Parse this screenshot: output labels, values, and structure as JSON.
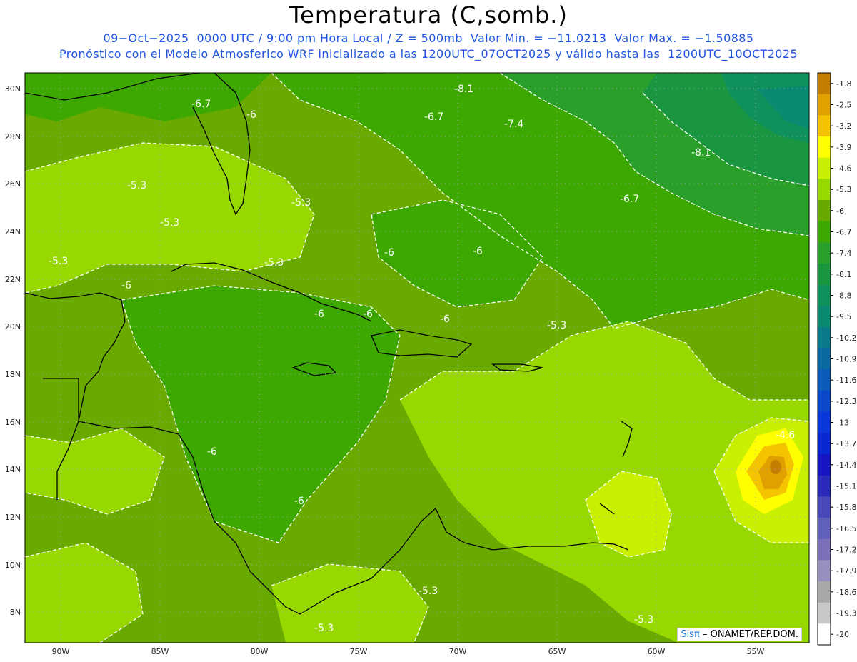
{
  "title": "Temperatura (C,somb.)",
  "subtitle_line1": "09−Oct−2025  0000 UTC / 9:00 pm Hora Local / Z = 500mb  Valor Min. = −11.0213  Valor Max. = −1.50885",
  "subtitle_line2": "Pronóstico con el Modelo Atmosferico WRF inicializado a las 1200UTC_07OCT2025 y válido hasta las  1200UTC_10OCT2025",
  "map": {
    "lon_ticks": [
      "90W",
      "85W",
      "80W",
      "75W",
      "70W",
      "65W",
      "60W",
      "55W"
    ],
    "lat_ticks": [
      "30N",
      "28N",
      "26N",
      "24N",
      "22N",
      "20N",
      "18N",
      "16N",
      "14N",
      "12N",
      "10N",
      "8N"
    ],
    "contour_labels": [
      "-6.7",
      "-6",
      "-8.1",
      "-6.7",
      "-7.4",
      "-8.1",
      "-5.3",
      "-5.3",
      "-5.3",
      "-6.7",
      "-5.3",
      "-6",
      "-6",
      "-5.3",
      "-6",
      "-6",
      "-6",
      "-6",
      "-5.3",
      "-4.6",
      "-6",
      "-6",
      "-5.3",
      "-5.3",
      "-5.3"
    ]
  },
  "colorbar": {
    "labels": [
      "-1.8",
      "-2.5",
      "-3.2",
      "-3.9",
      "-4.6",
      "-5.3",
      "-6",
      "-6.7",
      "-7.4",
      "-8.1",
      "-8.8",
      "-9.5",
      "-10.2",
      "-10.9",
      "-11.6",
      "-12.3",
      "-13",
      "-13.7",
      "-14.4",
      "-15.1",
      "-15.8",
      "-16.5",
      "-17.2",
      "-17.9",
      "-18.6",
      "-19.3",
      "-20"
    ],
    "colors": [
      "#c47f00",
      "#e0a000",
      "#f5c400",
      "#ffff00",
      "#c8f000",
      "#96d800",
      "#6aaa00",
      "#3ca800",
      "#2aa02a",
      "#1a9640",
      "#10905a",
      "#0a8a70",
      "#0a7a88",
      "#0a6aa0",
      "#0a5ab8",
      "#0a48c8",
      "#0a36d8",
      "#0a28d0",
      "#1414c0",
      "#2a2ab8",
      "#4848b8",
      "#6060b8",
      "#7a70b8",
      "#9a90c0",
      "#a8a8a8",
      "#c8c8c8",
      "#ffffff"
    ]
  },
  "badge": {
    "sis": "Sisπ",
    "text": "– ONAMET/REP.DOM."
  }
}
